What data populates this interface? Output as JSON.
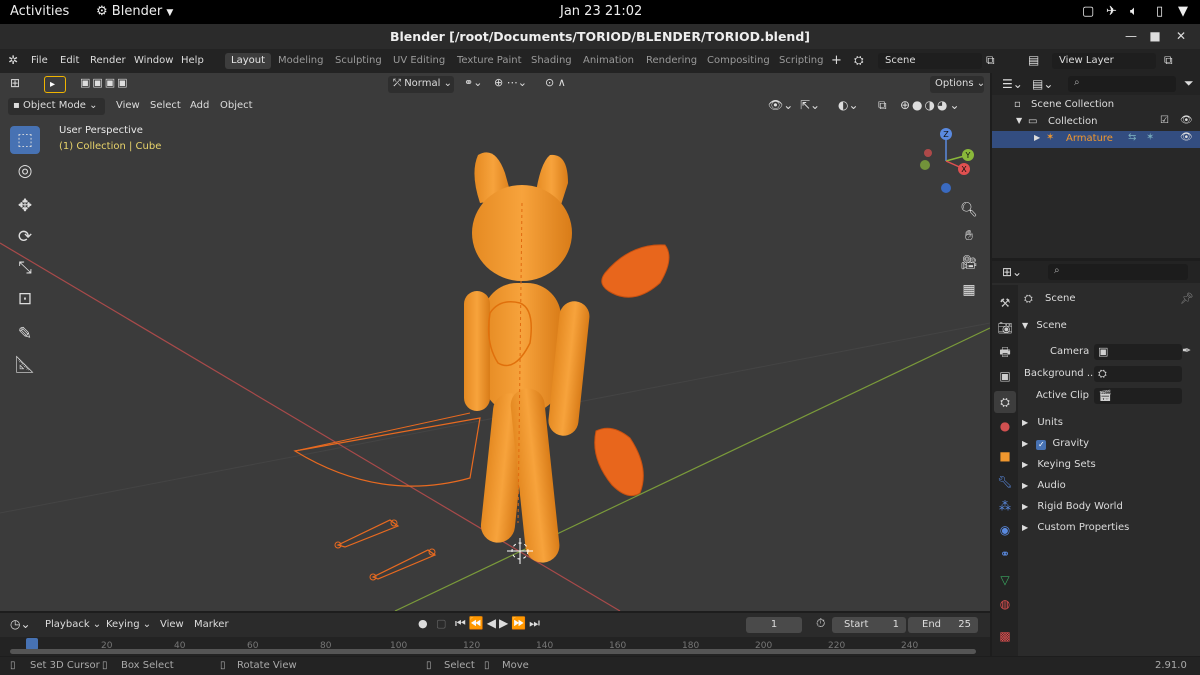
{
  "gnome": {
    "activities": "Activities",
    "app_name": "Blender",
    "datetime": "Jan 23  21:02"
  },
  "window": {
    "title": "Blender [/root/Documents/TORIOD/BLENDER/TORIOD.blend]"
  },
  "menubar": {
    "items": [
      "File",
      "Edit",
      "Render",
      "Window",
      "Help"
    ],
    "workspaces": [
      "Layout",
      "Modeling",
      "Sculpting",
      "UV Editing",
      "Texture Paint",
      "Shading",
      "Animation",
      "Rendering",
      "Compositing",
      "Scripting"
    ],
    "scene_name": "Scene",
    "view_layer": "View Layer"
  },
  "viewport": {
    "mode": "Object Mode",
    "menus": [
      "View",
      "Select",
      "Add",
      "Object"
    ],
    "orientation": "Normal",
    "options": "Options",
    "overlay_title": "User Perspective",
    "overlay_subtitle": "(1) Collection | Cube",
    "gizmo": {
      "x": "X",
      "y": "Y",
      "z": "Z"
    }
  },
  "outliner": {
    "scene_collection": "Scene Collection",
    "collection": "Collection",
    "armature": "Armature"
  },
  "properties": {
    "context": "Scene",
    "panel_title": "Scene",
    "camera_label": "Camera",
    "background_label": "Background ...",
    "active_clip_label": "Active Clip",
    "sections": [
      "Units",
      "Gravity",
      "Keying Sets",
      "Audio",
      "Rigid Body World",
      "Custom Properties"
    ]
  },
  "timeline": {
    "menus": [
      "Playback",
      "Keying",
      "View",
      "Marker"
    ],
    "current_frame": "1",
    "start_label": "Start",
    "start_value": "1",
    "end_label": "End",
    "end_value": "25",
    "ticks": [
      "20",
      "40",
      "60",
      "80",
      "100",
      "120",
      "140",
      "160",
      "180",
      "200",
      "220",
      "240"
    ]
  },
  "statusbar": {
    "set_cursor": "Set 3D Cursor",
    "box_select": "Box Select",
    "rotate_view": "Rotate View",
    "select": "Select",
    "move": "Move",
    "version": "2.91.0"
  },
  "colors": {
    "accent": "#4772b3",
    "selection_orange": "#f0972e",
    "active_object_orange": "#ff8c1a",
    "axis_red": "#a84a4a",
    "axis_green": "#7a9a3a"
  }
}
